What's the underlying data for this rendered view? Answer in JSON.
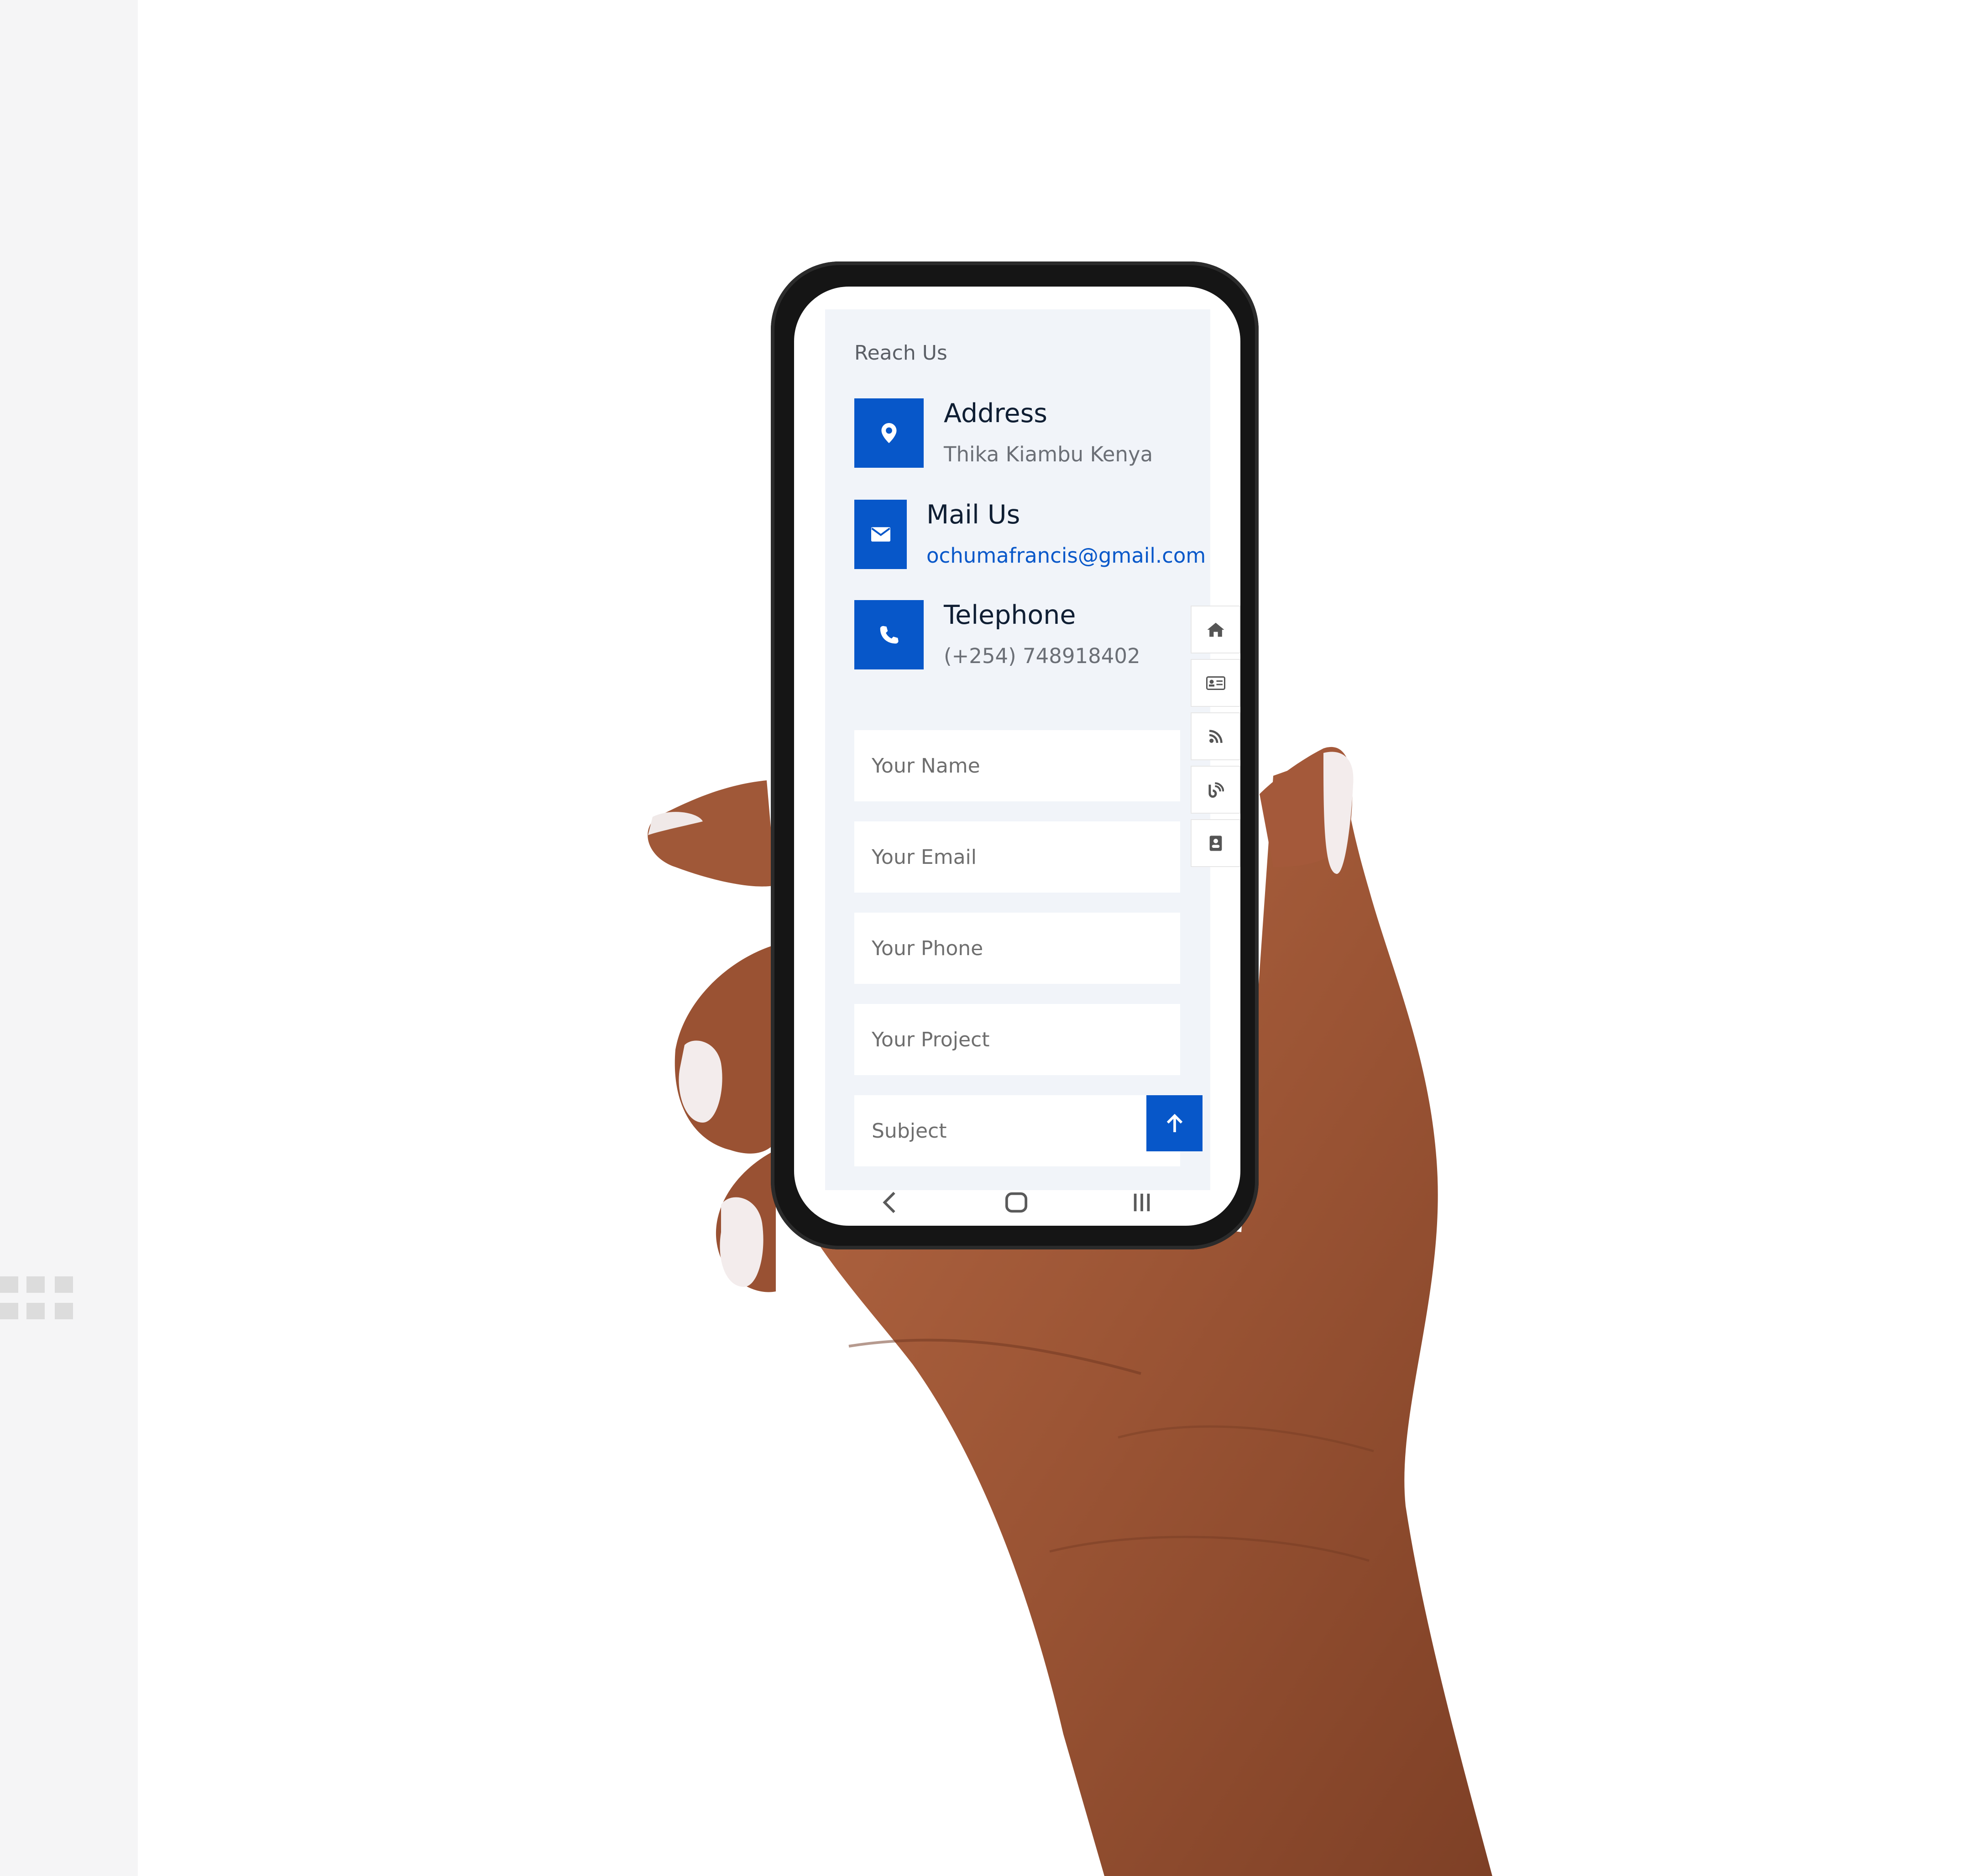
{
  "contact_section": {
    "heading": "Reach Us",
    "address": {
      "title": "Address",
      "value": "Thika Kiambu Kenya",
      "icon": "map-pin-icon"
    },
    "mail": {
      "title": "Mail Us",
      "value": "ochumafrancis@gmail.com",
      "icon": "envelope-icon"
    },
    "telephone": {
      "title": "Telephone",
      "value": "(+254) 748918402",
      "icon": "phone-icon"
    }
  },
  "form": {
    "name_placeholder": "Your Name",
    "email_placeholder": "Your Email",
    "phone_placeholder": "Your Phone",
    "project_placeholder": "Your Project",
    "subject_placeholder": "Subject"
  },
  "sidebar": {
    "items": [
      {
        "icon": "home-icon"
      },
      {
        "icon": "id-card-icon"
      },
      {
        "icon": "rss-icon"
      },
      {
        "icon": "blog-icon"
      },
      {
        "icon": "address-book-icon"
      }
    ]
  },
  "colors": {
    "accent": "#0757c9",
    "panel_bg": "#f1f4f9",
    "heading": "#0f1e33",
    "muted_text": "#6b6f76"
  }
}
